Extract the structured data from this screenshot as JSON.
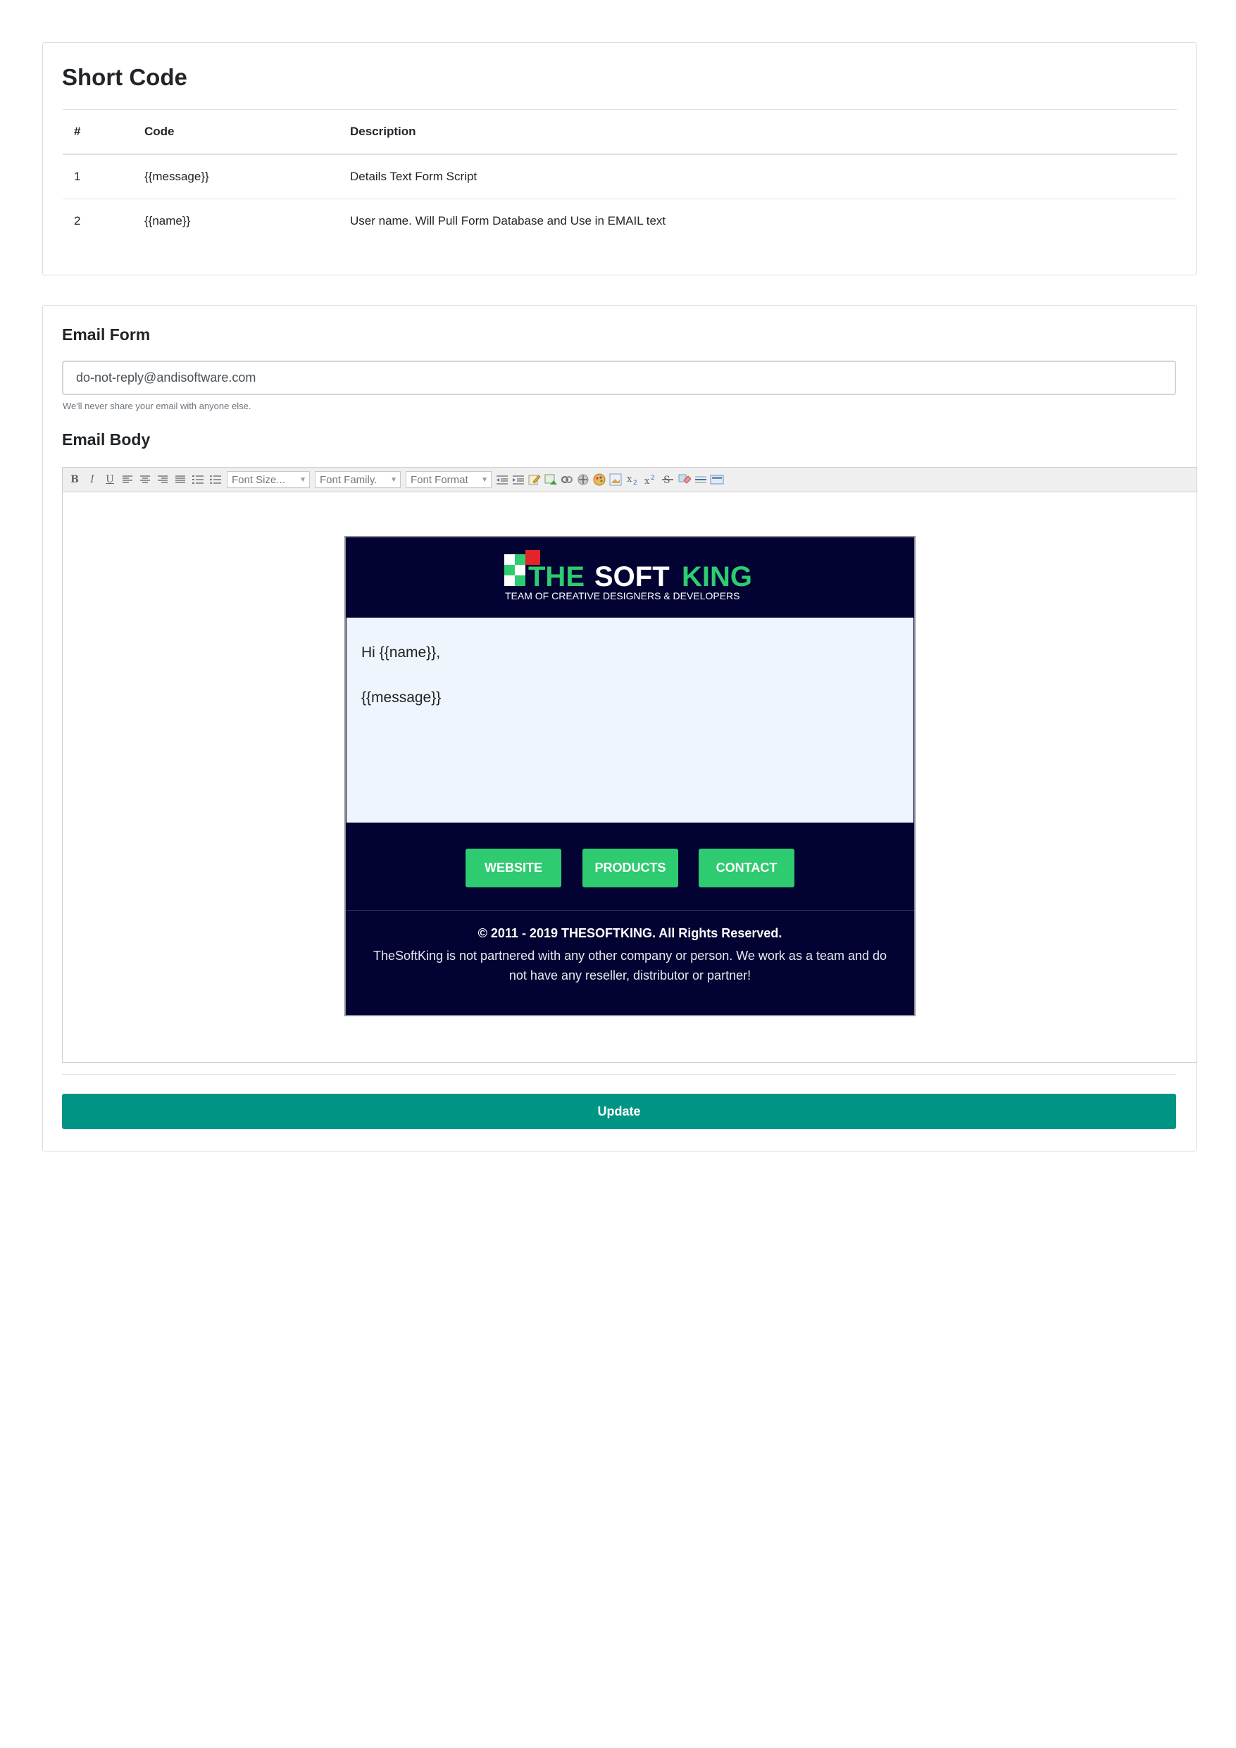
{
  "short_code": {
    "title": "Short Code",
    "headers": [
      "#",
      "Code",
      "Description"
    ],
    "rows": [
      {
        "num": "1",
        "code": "{{message}}",
        "description": "Details Text Form Script"
      },
      {
        "num": "2",
        "code": "{{name}}",
        "description": "User name. Will Pull Form Database and Use in EMAIL text"
      }
    ]
  },
  "email_form": {
    "label": "Email Form",
    "value": "do-not-reply@andisoftware.com",
    "help": "We'll never share your email with anyone else."
  },
  "email_body": {
    "label": "Email Body",
    "toolbar": {
      "bold": "B",
      "italic": "I",
      "underline": "U",
      "font_size": "Font Size...",
      "font_family": "Font Family.",
      "font_format": "Font Format"
    }
  },
  "template": {
    "logo_text_the": "THE",
    "logo_text_soft": "SOFT",
    "logo_text_king": "KING",
    "tagline": "TEAM OF CREATIVE DESIGNERS & DEVELOPERS",
    "greeting": "Hi {{name}},",
    "message": "{{message}}",
    "buttons": [
      "WEBSITE",
      "PRODUCTS",
      "CONTACT"
    ],
    "copyright": "© 2011 - 2019 THESOFTKING. All Rights Reserved.",
    "note": "TheSoftKing is not partnered with any other company or person. We work as a team and do not have any reseller, distributor or partner!",
    "colors": {
      "navy": "#020233",
      "green": "#2fcb71",
      "red": "#e3242b",
      "light": "#eef5fd"
    }
  },
  "update_label": "Update",
  "colors": {
    "accent": "#009485"
  }
}
